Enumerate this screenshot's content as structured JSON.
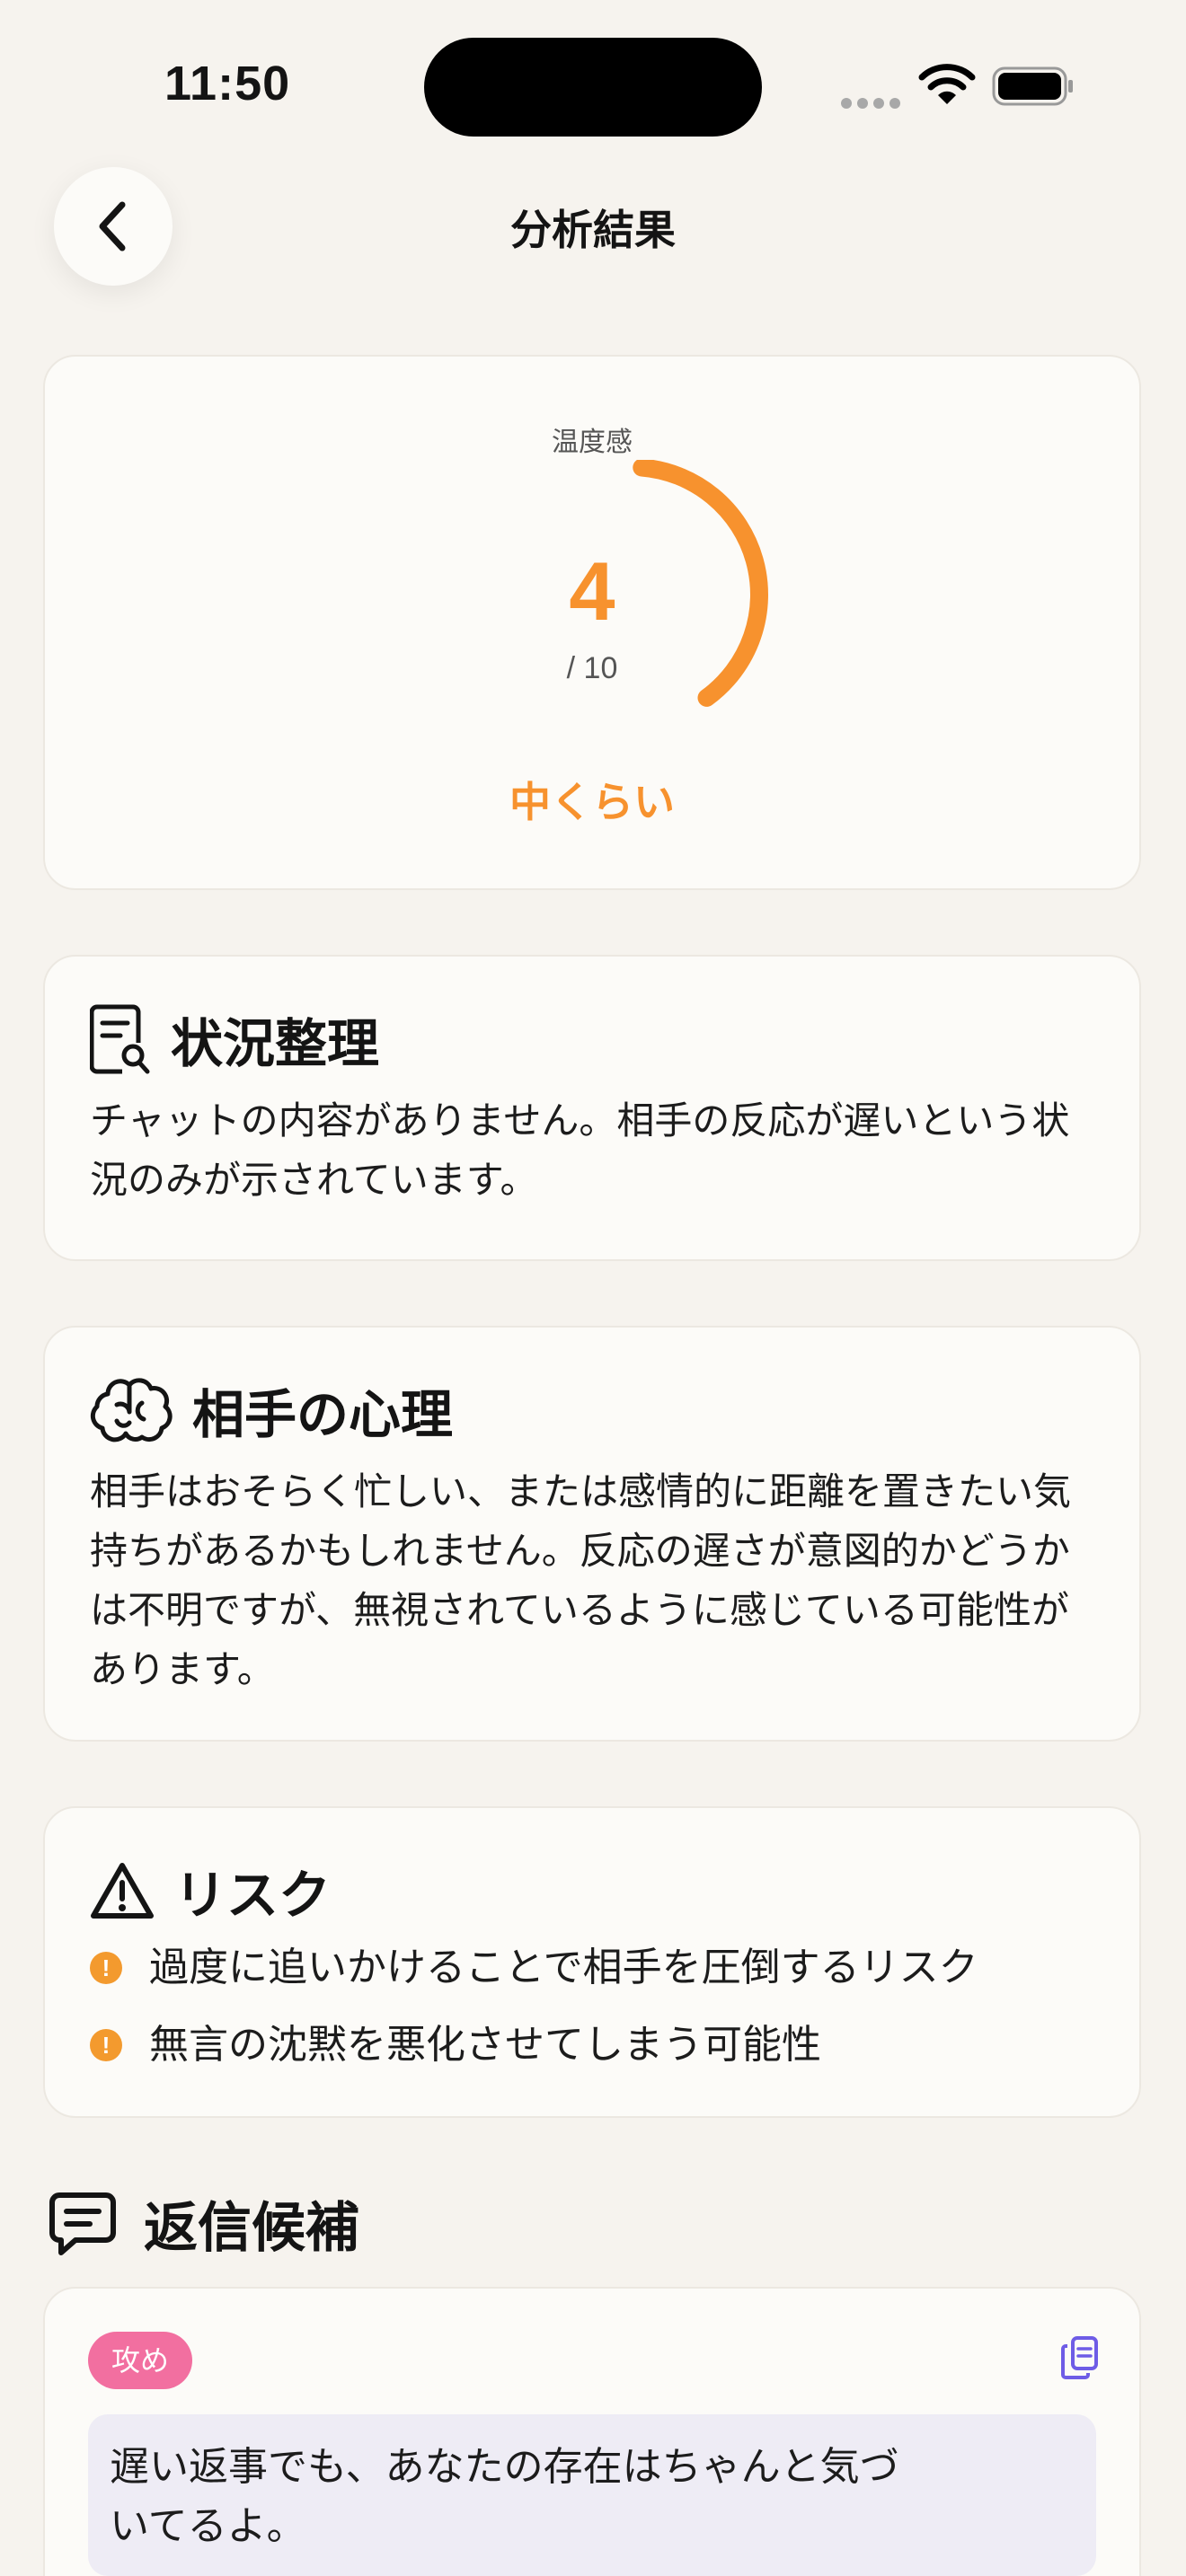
{
  "status_bar": {
    "time": "11:50"
  },
  "header": {
    "title": "分析結果"
  },
  "temperature": {
    "label": "温度感",
    "value": 4,
    "value_text": "4",
    "max_text": "/ 10",
    "level": "中くらい",
    "accent_color": "#F7922E"
  },
  "situation": {
    "title": "状況整理",
    "icon": "document-search-icon",
    "body": "チャットの内容がありません。相手の反応が遅いという状況のみが示されています。"
  },
  "psychology": {
    "title": "相手の心理",
    "icon": "brain-icon",
    "body": "相手はおそらく忙しい、または感情的に距離を置きたい気持ちがあるかもしれません。反応の遅さが意図的かどうかは不明ですが、無視されているように感じている可能性があります。"
  },
  "risk": {
    "title": "リスク",
    "icon": "warning-icon",
    "items": [
      {
        "text": "過度に追いかけることで相手を圧倒するリスク"
      },
      {
        "text": "無言の沈黙を悪化させてしまう可能性"
      }
    ],
    "bullet_color": "#F39A2E"
  },
  "replies": {
    "title": "返信候補",
    "icon": "message-icon",
    "items": [
      {
        "tag": "攻め",
        "text": "遅い返事でも、あなたの存在はちゃんと気づいてるよ。"
      }
    ]
  }
}
